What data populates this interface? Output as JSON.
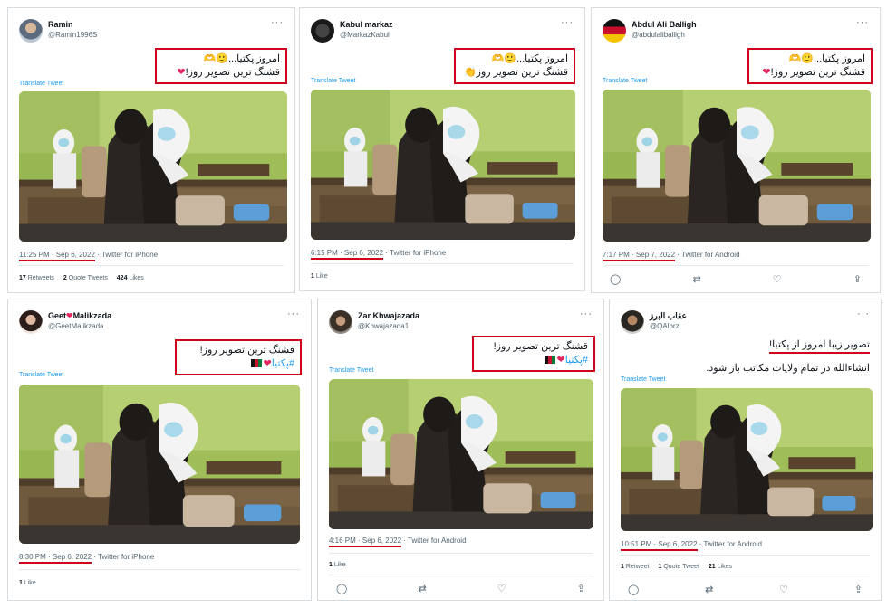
{
  "tweets": [
    {
      "name": "Ramin",
      "handle": "@Ramin1996S",
      "line1": "امروز پکتیا...🙂🫶",
      "line2": "قشنگ ترین تصویر روز!",
      "translate": "Translate Tweet",
      "time": "11:25 PM · Sep 6, 2022",
      "source": "· Twitter for iPhone",
      "stats": [
        {
          "num": "17",
          "label": "Retweets"
        },
        {
          "num": "2",
          "label": "Quote Tweets"
        },
        {
          "num": "424",
          "label": "Likes"
        }
      ]
    },
    {
      "name": "Kabul markaz",
      "handle": "@MarkazKabul",
      "line1": "امروز پکتیا...🙂🫶",
      "line2": "قشنگ ترین تصویر روز👏",
      "translate": "Translate Tweet",
      "time": "6:15 PM · Sep 6, 2022",
      "source": "· Twitter for iPhone",
      "stats": [
        {
          "num": "1",
          "label": "Like"
        }
      ]
    },
    {
      "name": "Abdul Ali Balligh",
      "handle": "@abdulaliballigh",
      "line1": "امروز پکتیا...🙂🫶",
      "line2": "قشنگ ترین تصویر روز!",
      "translate": "Translate Tweet",
      "time": "7:17 PM · Sep 7, 2022",
      "source": "· Twitter for Android"
    },
    {
      "name_a": "Geet",
      "name_b": "Malikzada",
      "handle": "@GeetMalikzada",
      "line1": "قشنگ ترین تصویر روز!",
      "hashtag": "#پکتیا",
      "translate": "Translate Tweet",
      "time": "8:30 PM · Sep 6, 2022",
      "source": "· Twitter for iPhone",
      "stats": [
        {
          "num": "1",
          "label": "Like"
        }
      ]
    },
    {
      "name": "Zar Khwajazada",
      "handle": "@Khwajazada1",
      "line1": "قشنگ ترین تصویر روز!",
      "hashtag": "#پکتیا",
      "translate": "Translate Tweet",
      "time": "4:16 PM · Sep 6, 2022",
      "source": "· Twitter for Android",
      "stats": [
        {
          "num": "1",
          "label": "Like"
        }
      ]
    },
    {
      "name": "عقاب البرز",
      "handle": "@QAlbrz",
      "line1": "تصویر زیبا امروز از پکتیا!",
      "line2": "انشاءالله در تمام ولایات مکاتب باز شود.",
      "translate": "Translate Tweet",
      "time": "10:51 PM · Sep 6, 2022",
      "source": "· Twitter for Android",
      "stats": [
        {
          "num": "1",
          "label": "Retweet"
        },
        {
          "num": "1",
          "label": "Quote Tweet"
        },
        {
          "num": "21",
          "label": "Likes"
        }
      ]
    }
  ],
  "icons": {
    "more": "···",
    "heart": "❤",
    "reply": "◯",
    "retweet": "⇄",
    "like": "♡",
    "share": "⇪"
  },
  "colors": {
    "highlight_red": "#d0021b",
    "link_blue": "#1d9bf0",
    "heart_red": "#e0245e"
  }
}
